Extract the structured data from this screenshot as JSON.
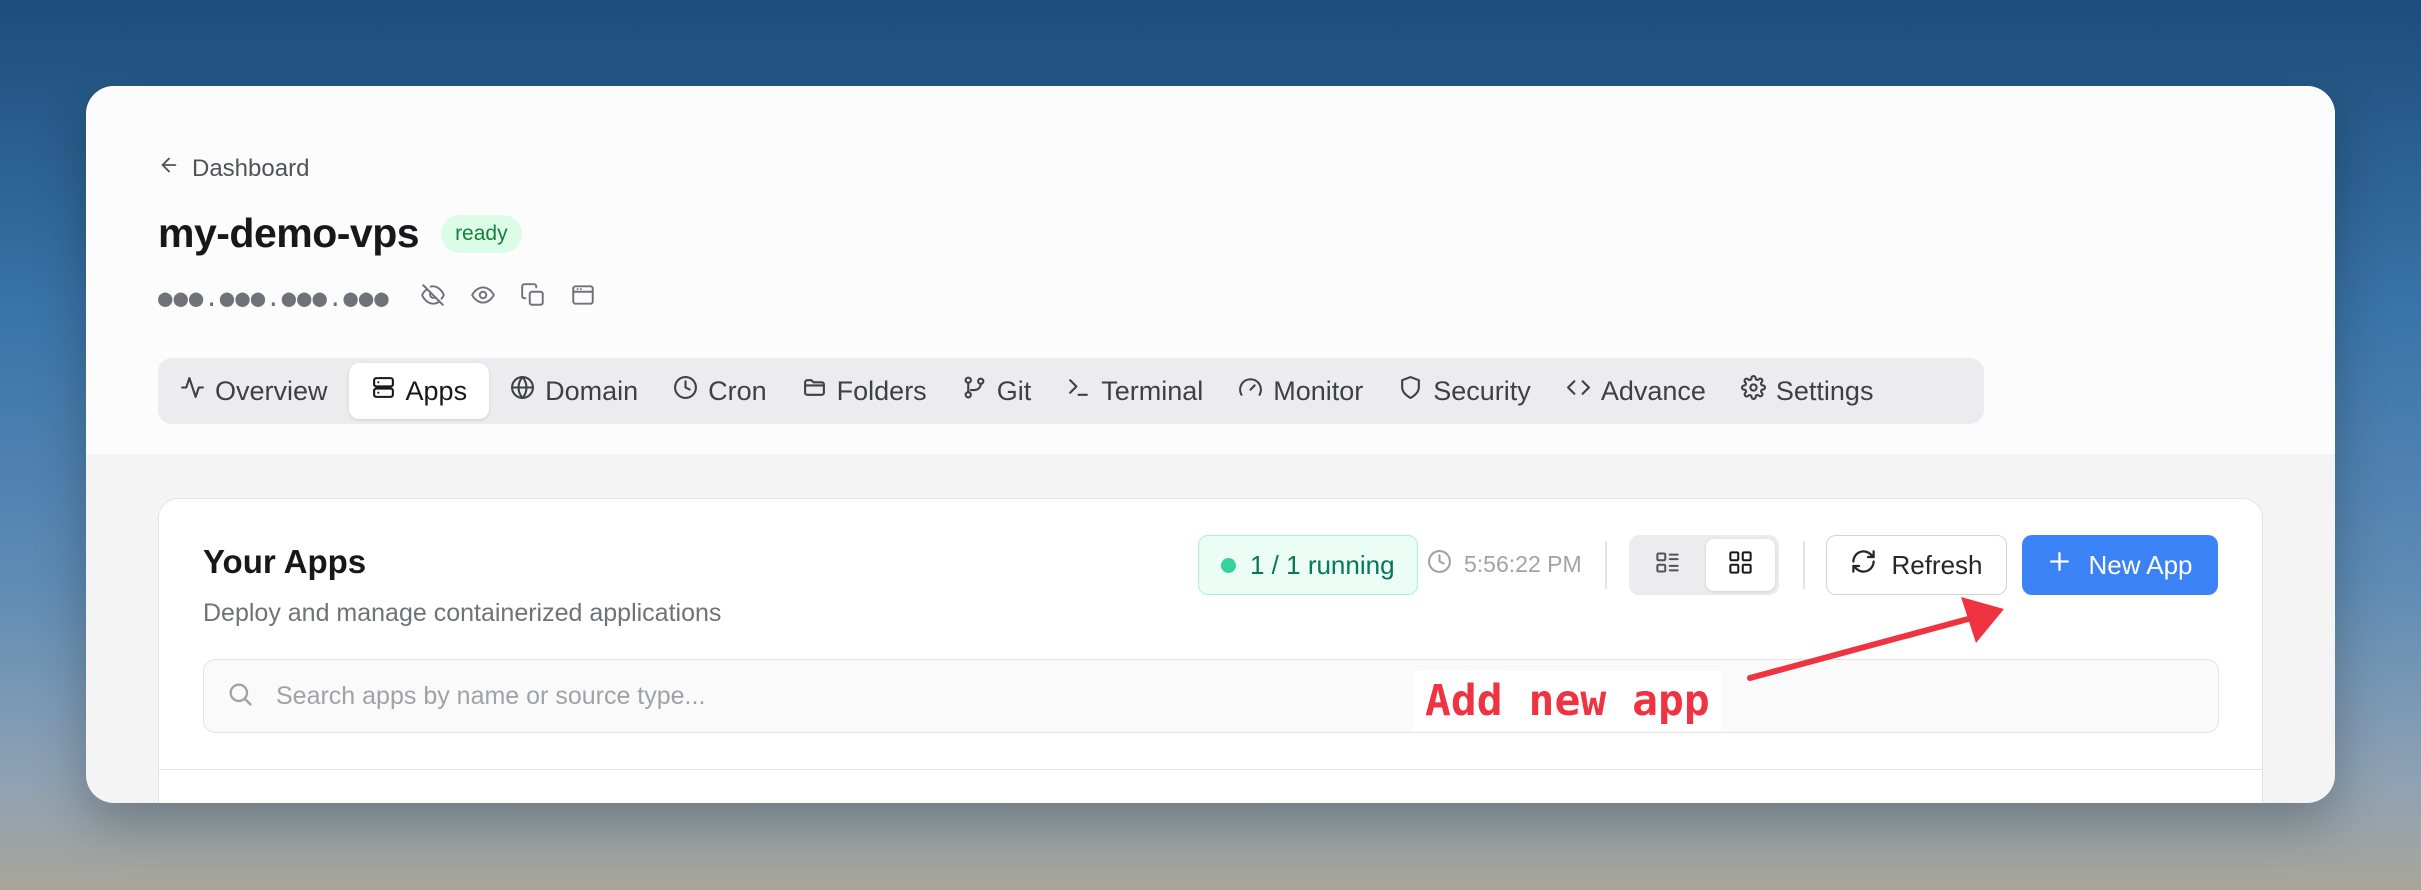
{
  "breadcrumb": {
    "back_label": "Dashboard"
  },
  "server": {
    "name": "my-demo-vps",
    "status": "ready",
    "ip_masked": "●●●.●●●.●●●.●●●"
  },
  "tabs": [
    {
      "label": "Overview",
      "icon": "activity-icon"
    },
    {
      "label": "Apps",
      "icon": "server-icon",
      "active": true
    },
    {
      "label": "Domain",
      "icon": "globe-icon"
    },
    {
      "label": "Cron",
      "icon": "clock-icon"
    },
    {
      "label": "Folders",
      "icon": "folder-icon"
    },
    {
      "label": "Git",
      "icon": "git-branch-icon"
    },
    {
      "label": "Terminal",
      "icon": "terminal-icon"
    },
    {
      "label": "Monitor",
      "icon": "gauge-icon"
    },
    {
      "label": "Security",
      "icon": "shield-icon"
    },
    {
      "label": "Advance",
      "icon": "code-icon"
    },
    {
      "label": "Settings",
      "icon": "gear-icon"
    }
  ],
  "apps_panel": {
    "title": "Your Apps",
    "subtitle": "Deploy and manage containerized applications",
    "running_status": "1 / 1 running",
    "last_updated": "5:56:22 PM",
    "view_mode": "grid",
    "refresh_label": "Refresh",
    "new_app_label": "New App",
    "search_placeholder": "Search apps by name or source type...",
    "search_value": ""
  },
  "annotation": {
    "text": "Add new app",
    "color": "#ef3340"
  },
  "colors": {
    "primary": "#3b82f6",
    "success": "#047857",
    "annotation": "#ef3340"
  }
}
